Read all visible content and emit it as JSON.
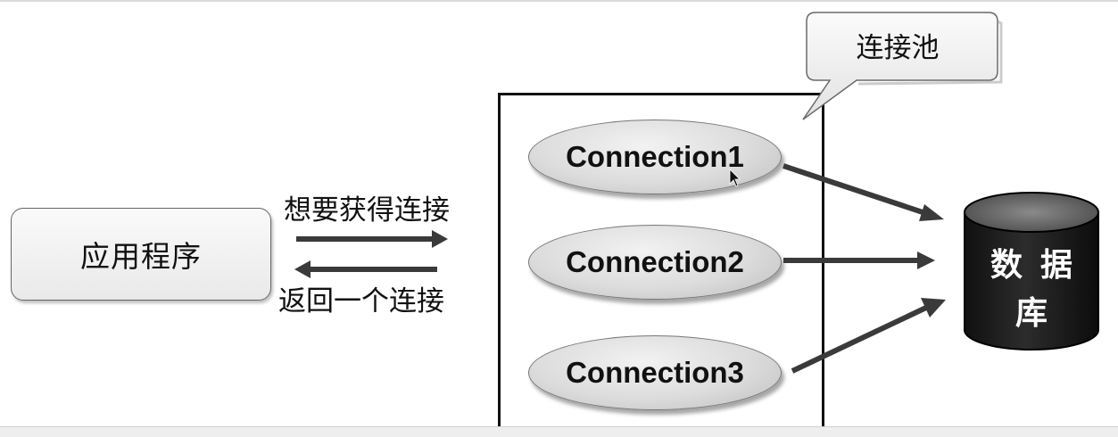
{
  "app": {
    "label": "应用程序"
  },
  "arrows": {
    "request_label": "想要获得连接",
    "return_label": "返回一个连接"
  },
  "pool": {
    "callout_label": "连接池",
    "connections": [
      "Connection1",
      "Connection2",
      "Connection3"
    ]
  },
  "database": {
    "label_chars": [
      "数",
      "据",
      "库"
    ]
  },
  "colors": {
    "arrow": "#3a3a3a",
    "database_fill": "#1e1e1e",
    "ellipse_fill": "#d8d8d8"
  }
}
